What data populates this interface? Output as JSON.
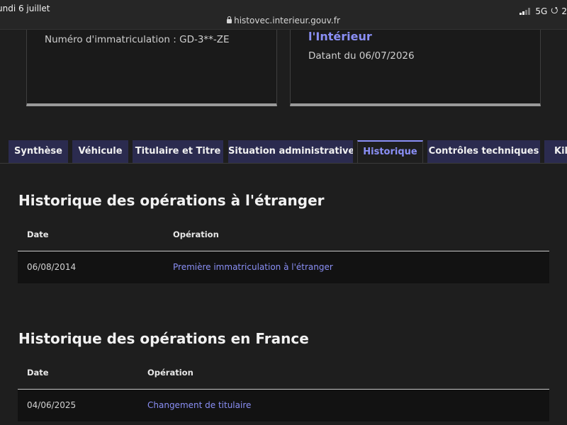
{
  "status_bar": {
    "time_date": "undi 6 juillet",
    "network": "5G",
    "battery_partial": "2"
  },
  "browser": {
    "url": "histovec.interieur.gouv.fr"
  },
  "cards": {
    "left": {
      "plate_text": "Numéro d'immatriculation : GD-3**-ZE"
    },
    "right": {
      "title": "l'Intérieur",
      "date_text": "Datant du 06/07/2026"
    }
  },
  "tabs": [
    {
      "label": "Synthèse",
      "active": false
    },
    {
      "label": "Véhicule",
      "active": false
    },
    {
      "label": "Titulaire et Titre",
      "active": false
    },
    {
      "label": "Situation administrative",
      "active": false
    },
    {
      "label": "Historique",
      "active": true
    },
    {
      "label": "Contrôles techniques",
      "active": false
    },
    {
      "label": "Kilo",
      "active": false
    }
  ],
  "sections": {
    "foreign": {
      "title": "Historique des opérations à l'étranger",
      "headers": {
        "date": "Date",
        "operation": "Opération"
      },
      "rows": [
        {
          "date": "06/08/2014",
          "operation": "Première immatriculation à l'étranger"
        }
      ]
    },
    "france": {
      "title": "Historique des opérations en France",
      "headers": {
        "date": "Date",
        "operation": "Opération"
      },
      "rows": [
        {
          "date": "04/06/2025",
          "operation": "Changement de titulaire"
        }
      ]
    }
  },
  "colors": {
    "accent": "#8a8ff5",
    "tab_background": "#2b2b4f",
    "page_background": "#1e1e1e"
  }
}
